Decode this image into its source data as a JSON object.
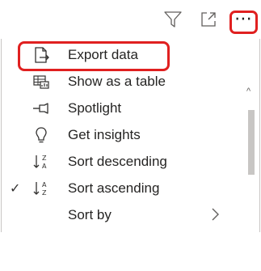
{
  "header": {
    "filter_icon": "filter-icon",
    "focus_icon": "focus-mode-icon",
    "more_label": "⋯"
  },
  "menu": {
    "items": [
      {
        "label": "Export data",
        "icon": "export-data-icon",
        "checked": false,
        "highlighted": true
      },
      {
        "label": "Show as a table",
        "icon": "show-as-table-icon",
        "checked": false
      },
      {
        "label": "Spotlight",
        "icon": "spotlight-icon",
        "checked": false
      },
      {
        "label": "Get insights",
        "icon": "lightbulb-icon",
        "checked": false
      },
      {
        "label": "Sort descending",
        "icon": "sort-descending-icon",
        "checked": false
      },
      {
        "label": "Sort ascending",
        "icon": "sort-ascending-icon",
        "checked": true,
        "check_mark": "✓"
      },
      {
        "label": "Sort by",
        "icon": "",
        "checked": false,
        "has_submenu": true
      }
    ]
  },
  "colors": {
    "highlight_border": "#e02020",
    "text": "#252423",
    "scroll_thumb": "#c8c6c4"
  }
}
